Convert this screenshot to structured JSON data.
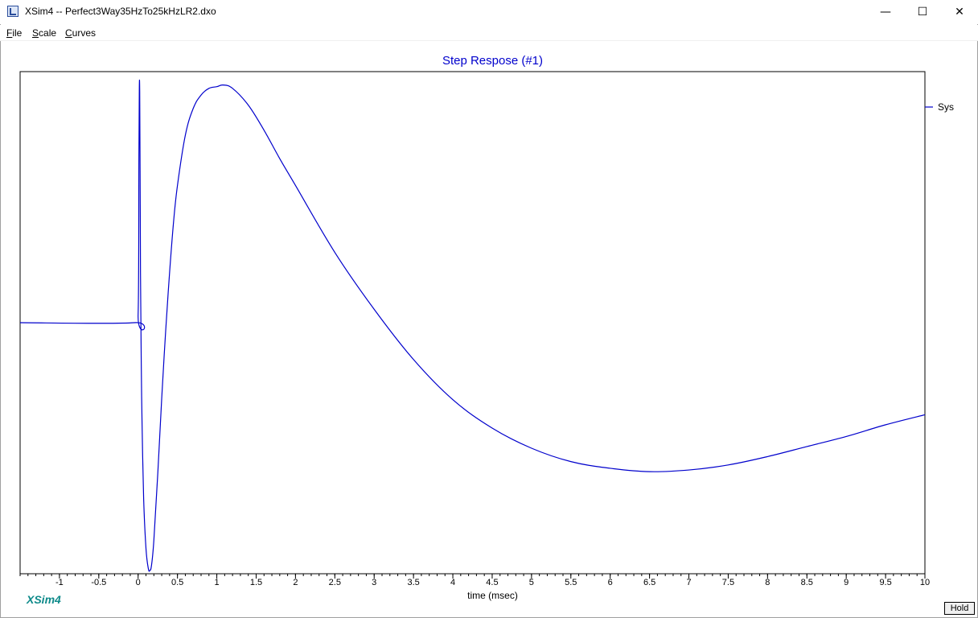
{
  "window": {
    "title": "XSim4 -- Perfect3Way35HzTo25kHzLR2.dxo",
    "minimize": "—",
    "maximize": "☐",
    "close": "✕"
  },
  "menu": {
    "items": [
      {
        "accel": "F",
        "rest": "ile"
      },
      {
        "accel": "S",
        "rest": "cale"
      },
      {
        "accel": "C",
        "rest": "urves"
      }
    ]
  },
  "brand": "XSim4",
  "hold_label": "Hold",
  "colors": {
    "curve": "#0000cc",
    "title": "#0000cc",
    "brand": "#0e8a8a",
    "axis": "#000000"
  },
  "chart_data": {
    "type": "line",
    "title": "Step Respose (#1)",
    "xlabel": "time (msec)",
    "ylabel": "",
    "xlim": [
      -1.5,
      10
    ],
    "ylim": [
      -1.5,
      1.5
    ],
    "grid": false,
    "legend_position": "top-right",
    "xticks": [
      -1,
      -0.5,
      0,
      0.5,
      1,
      1.5,
      2,
      2.5,
      3,
      3.5,
      4,
      4.5,
      5,
      5.5,
      6,
      6.5,
      7,
      7.5,
      8,
      8.5,
      9,
      9.5,
      10
    ],
    "xtick_labels": [
      "-1",
      "-0.5",
      "0",
      "0.5",
      "1",
      "1.5",
      "2",
      "2.5",
      "3",
      "3.5",
      "4",
      "4.5",
      "5",
      "5.5",
      "6",
      "6.5",
      "7",
      "7.5",
      "8",
      "8.5",
      "9",
      "9.5",
      "10"
    ],
    "series": [
      {
        "name": "Sys",
        "x": [
          -1.5,
          -0.05,
          0.0,
          0.01,
          0.015,
          0.02,
          0.025,
          0.03,
          0.04,
          0.05,
          0.07,
          0.1,
          0.13,
          0.15,
          0.17,
          0.2,
          0.25,
          0.3,
          0.35,
          0.4,
          0.45,
          0.5,
          0.6,
          0.7,
          0.8,
          0.9,
          1.0,
          1.08,
          1.2,
          1.4,
          1.6,
          1.8,
          2.0,
          2.5,
          3.0,
          3.5,
          4.0,
          4.5,
          5.0,
          5.5,
          6.0,
          6.5,
          7.0,
          7.5,
          8.0,
          8.5,
          9.0,
          9.5,
          10.0
        ],
        "y": [
          0.0,
          0.0,
          0.05,
          1.0,
          1.4,
          1.38,
          0.9,
          0.3,
          -0.25,
          -0.6,
          -1.05,
          -1.35,
          -1.47,
          -1.48,
          -1.45,
          -1.3,
          -0.9,
          -0.45,
          -0.05,
          0.3,
          0.6,
          0.82,
          1.12,
          1.28,
          1.36,
          1.4,
          1.41,
          1.42,
          1.4,
          1.3,
          1.15,
          0.98,
          0.82,
          0.42,
          0.08,
          -0.22,
          -0.46,
          -0.63,
          -0.75,
          -0.83,
          -0.87,
          -0.89,
          -0.88,
          -0.85,
          -0.8,
          -0.74,
          -0.68,
          -0.61,
          -0.55
        ]
      }
    ]
  }
}
